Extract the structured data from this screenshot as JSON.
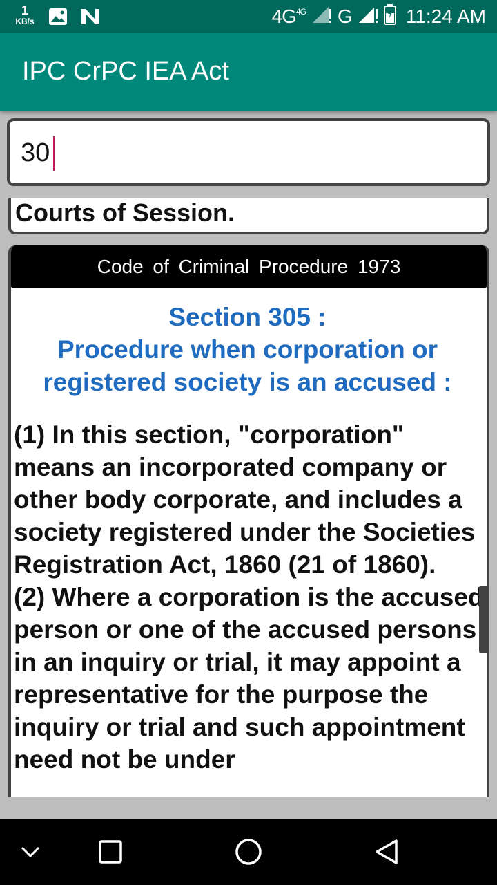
{
  "status_bar": {
    "speed_value": "1",
    "speed_unit": "KB/s",
    "network": "4G",
    "network_sup": "4G",
    "signal2": "G",
    "time": "11:24 AM",
    "icons": [
      "image-icon",
      "n-notification-icon",
      "signal-icon",
      "battery-icon"
    ]
  },
  "app_bar": {
    "title": "IPC CrPC IEA Act"
  },
  "search": {
    "value": "30",
    "placeholder": ""
  },
  "previous_result": {
    "text": "Courts of Session."
  },
  "result": {
    "header": "Code of Criminal Procedure 1973",
    "section_heading": "Section 305 :",
    "section_title": "Procedure when corporation or registered society is an accused :",
    "body": "(1) In this section, \"corporation\" means an incorporated company or other body corporate, and includes a society registered under the Societies Registration Act, 1860 (21 of 1860).\n(2) Where a corporation is the accused person or one of the accused persons in an inquiry or trial, it may appoint a representative for the purpose the inquiry or trial and such appointment need not be under"
  },
  "colors": {
    "status_bar": "#00695c",
    "app_bar": "#00897b",
    "section_title": "#1e6bbf",
    "caret": "#c2185b"
  },
  "nav_bar": {
    "icons": [
      "chevron-down-icon",
      "recents-icon",
      "home-icon",
      "back-icon"
    ]
  }
}
